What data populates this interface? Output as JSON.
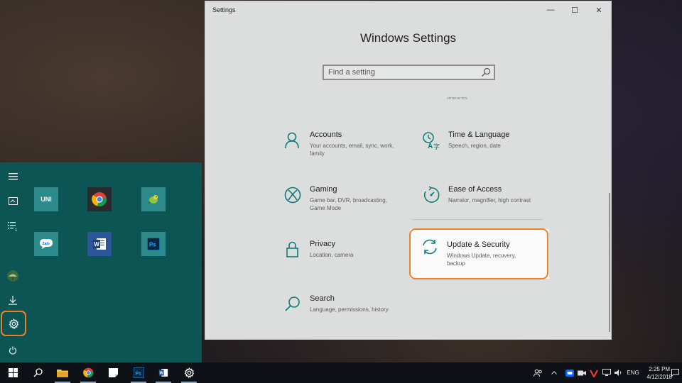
{
  "settings_window": {
    "title": "Settings",
    "controls": {
      "minimize": "—",
      "maximize": "☐",
      "close": "✕"
    },
    "page_title": "Windows Settings",
    "search": {
      "placeholder": "Find a setting",
      "value": ""
    },
    "cut_off_text": "features",
    "categories": [
      {
        "name": "Accounts",
        "desc": "Your accounts, email, sync, work, family",
        "icon": "person-icon"
      },
      {
        "name": "Time & Language",
        "desc": "Speech, region, date",
        "icon": "time-language-icon"
      },
      {
        "name": "Gaming",
        "desc": "Game bar, DVR, broadcasting, Game Mode",
        "icon": "xbox-icon"
      },
      {
        "name": "Ease of Access",
        "desc": "Narrator, magnifier, high contrast",
        "icon": "ease-of-access-icon"
      },
      {
        "name": "Privacy",
        "desc": "Location, camera",
        "icon": "lock-icon"
      },
      {
        "name": "Update & Security",
        "desc": "Windows Update, recovery, backup",
        "icon": "refresh-icon",
        "selected": true
      },
      {
        "name": "Search",
        "desc": "Language, permissions, history",
        "icon": "search-icon"
      }
    ]
  },
  "start_menu": {
    "rail": [
      "hamburger-menu-icon",
      "tiles-icon",
      "all-apps-icon",
      "user-avatar",
      "downloads-icon",
      "gear-icon",
      "power-icon"
    ],
    "tiles": [
      {
        "label": "UNI",
        "icon": "uni-app-icon",
        "color": "#2d8a8a"
      },
      {
        "label": "",
        "icon": "chrome-icon",
        "color": "#2b2b2b"
      },
      {
        "label": "",
        "icon": "parrot-app-icon",
        "color": "#2d8a8a"
      },
      {
        "label": "Zalo",
        "icon": "zalo-icon",
        "color": "#2d8a8a"
      },
      {
        "label": "W",
        "icon": "word-icon",
        "color": "#2a5699"
      },
      {
        "label": "Ps",
        "icon": "photoshop-icon",
        "color": "#2d8a8a"
      }
    ]
  },
  "taskbar": {
    "apps": [
      "windows-start-icon",
      "search-icon",
      "file-explorer-icon",
      "chrome-icon",
      "sticky-notes-icon",
      "photoshop-icon",
      "word-icon",
      "settings-icon"
    ],
    "tray": {
      "language": "ENG",
      "time": "2:25 PM",
      "date": "4/12/2018"
    }
  },
  "colors": {
    "accent": "#0f7a7a",
    "start_bg": "#0d5454",
    "highlight": "#f07f2a",
    "window_bg": "#dcdddd"
  }
}
